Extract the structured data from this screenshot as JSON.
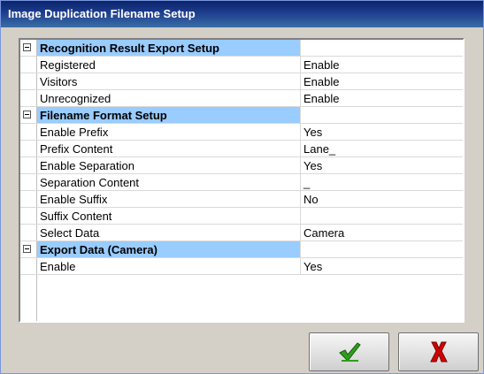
{
  "window": {
    "title": "Image Duplication Filename Setup"
  },
  "grid": {
    "rows": [
      {
        "type": "category",
        "name": "Recognition Result Export Setup",
        "value": ""
      },
      {
        "type": "property",
        "name": "Registered",
        "value": "Enable"
      },
      {
        "type": "property",
        "name": "Visitors",
        "value": "Enable"
      },
      {
        "type": "property",
        "name": "Unrecognized",
        "value": "Enable"
      },
      {
        "type": "category",
        "name": "Filename Format Setup",
        "value": ""
      },
      {
        "type": "property",
        "name": "Enable Prefix",
        "value": "Yes"
      },
      {
        "type": "property",
        "name": "Prefix Content",
        "value": "Lane_"
      },
      {
        "type": "property",
        "name": "Enable Separation",
        "value": "Yes"
      },
      {
        "type": "property",
        "name": "Separation Content",
        "value": "_"
      },
      {
        "type": "property",
        "name": "Enable Suffix",
        "value": "No"
      },
      {
        "type": "property",
        "name": "Suffix Content",
        "value": ""
      },
      {
        "type": "property",
        "name": "Select Data",
        "value": "Camera"
      },
      {
        "type": "category",
        "name": "Export Data (Camera)",
        "value": ""
      },
      {
        "type": "property",
        "name": "Enable",
        "value": "Yes"
      }
    ]
  },
  "buttons": {
    "ok_icon": "green-checkmark-icon",
    "cancel_icon": "red-x-icon"
  },
  "colors": {
    "category_band": "#99ccff",
    "ok_green": "#2e9e1c",
    "cancel_red": "#d20000"
  }
}
